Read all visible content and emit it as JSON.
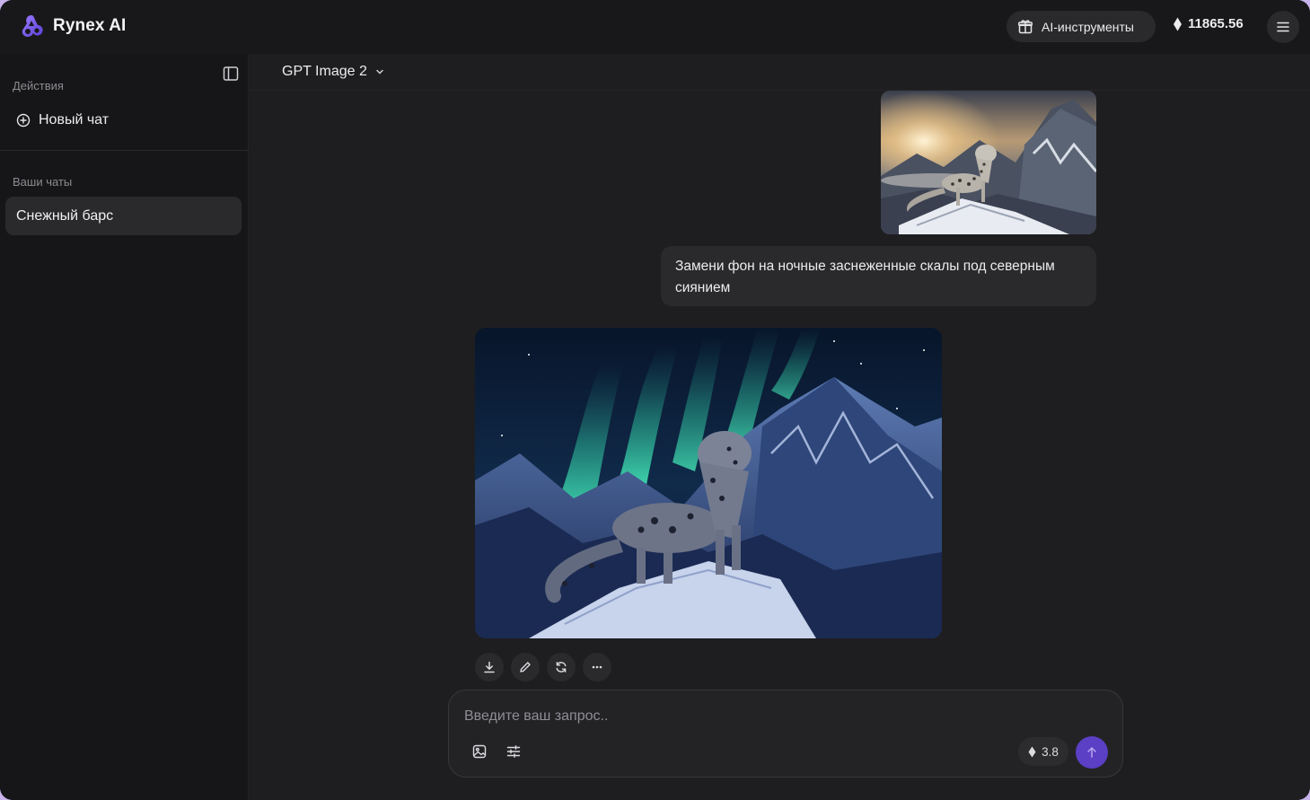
{
  "app": {
    "name": "Rynex AI",
    "brand_color": "#7b5cf0"
  },
  "header": {
    "tools_label": "AI-инструменты",
    "balance": "11865.56"
  },
  "sidebar": {
    "actions_title": "Действия",
    "new_chat_label": "Новый чат",
    "chats_title": "Ваши чаты",
    "chats": [
      {
        "label": "Снежный барс",
        "active": true
      }
    ]
  },
  "main": {
    "model": "GPT Image 2",
    "messages": [
      {
        "role": "user",
        "image": "snow-leopard-on-sunlit-mountain-ridge",
        "text": "Замени фон на ночные заснеженные скалы под северным сиянием"
      },
      {
        "role": "assistant",
        "image": "snow-leopard-under-northern-lights"
      }
    ],
    "result_actions": [
      "download-icon",
      "edit-icon",
      "regenerate-icon",
      "more-icon"
    ]
  },
  "composer": {
    "placeholder": "Введите ваш запрос..",
    "cost": "3.8",
    "send_color": "#5b3fc4"
  }
}
